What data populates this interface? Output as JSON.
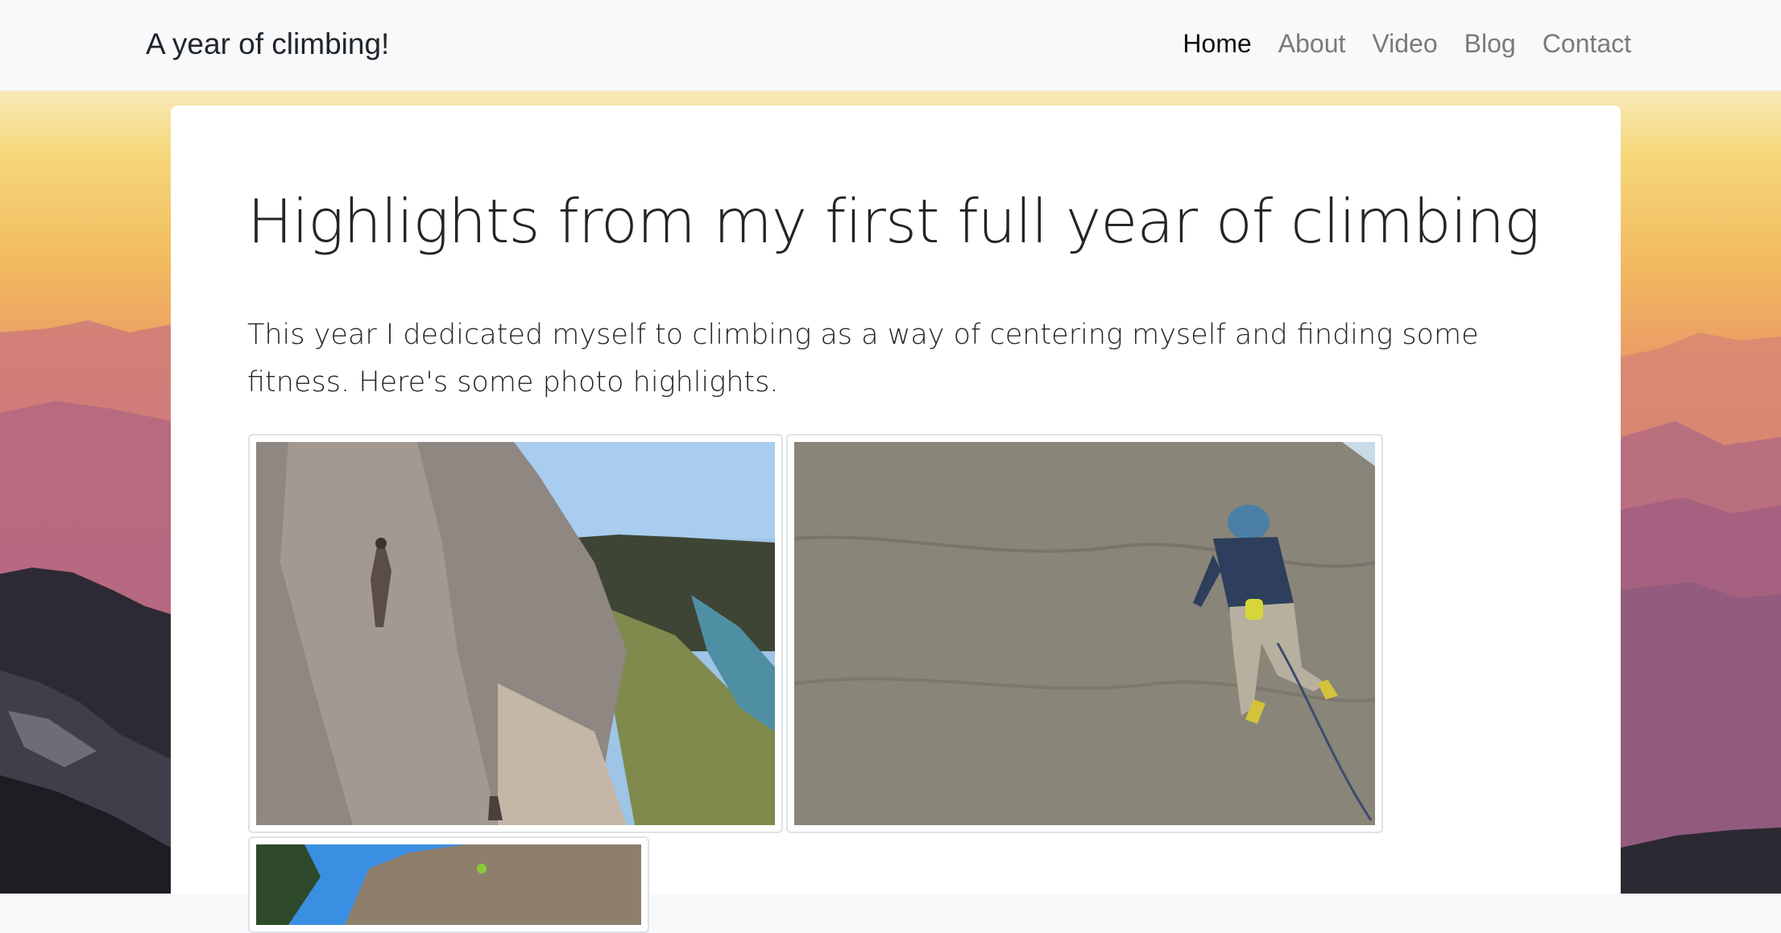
{
  "navbar": {
    "brand": "A year of climbing!",
    "links": [
      {
        "label": "Home",
        "active": true
      },
      {
        "label": "About",
        "active": false
      },
      {
        "label": "Video",
        "active": false
      },
      {
        "label": "Blog",
        "active": false
      },
      {
        "label": "Contact",
        "active": false
      }
    ]
  },
  "main": {
    "title": "Highlights from my first full year of climbing",
    "intro": "This year I dedicated myself to climbing as a way of centering myself and finding some fitness. Here's some photo highlights."
  },
  "gallery": {
    "photos": [
      {
        "subject": "climber on a limestone wall above a river canyon"
      },
      {
        "subject": "climber in blue jacket and helmet on a slab"
      },
      {
        "subject": "climbing photo under blue sky, partially visible"
      }
    ]
  },
  "colors": {
    "navbar_bg": "#f8f9fa",
    "text": "#212529",
    "nav_muted": "#7a7a7a",
    "thumb_border": "#dee2e6"
  }
}
